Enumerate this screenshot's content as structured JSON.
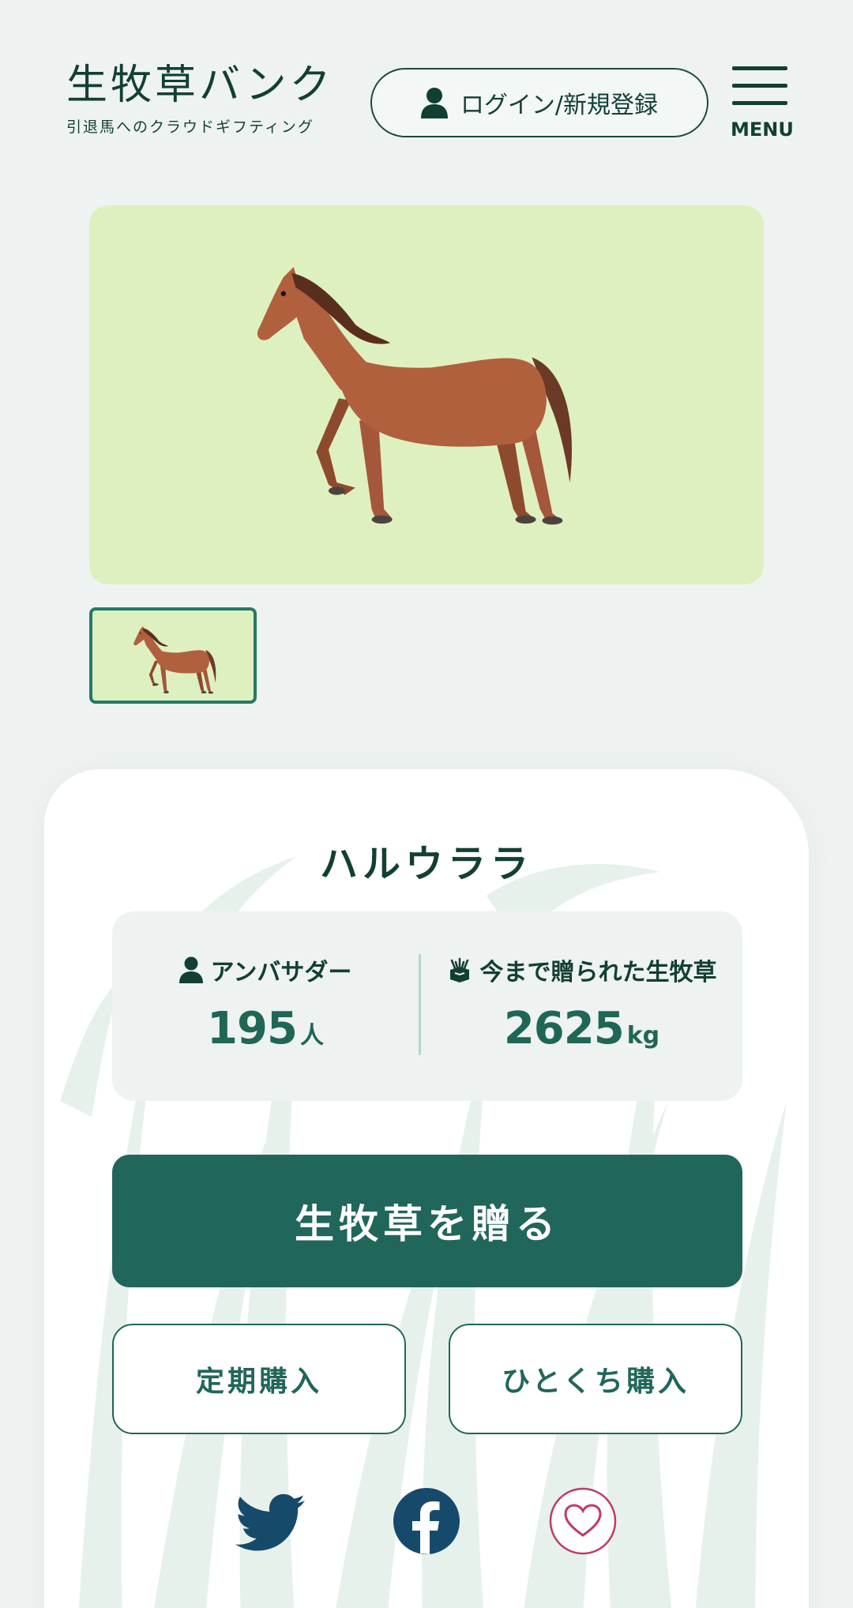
{
  "header": {
    "logo_title": "生牧草バンク",
    "logo_subtitle": "引退馬へのクラウドギフティング",
    "login_label": "ログイン/新規登録",
    "menu_label": "MENU"
  },
  "gallery": {
    "main_image": "horse-image",
    "thumbnails": [
      "horse-thumbnail"
    ]
  },
  "horse": {
    "name": "ハルウララ",
    "stats": {
      "ambassador_label": "アンバサダー",
      "ambassador_count": "195",
      "ambassador_unit": "人",
      "gifted_label": "今まで贈られた生牧草",
      "gifted_amount": "2625",
      "gifted_unit": "kg"
    }
  },
  "actions": {
    "gift_label": "生牧草を贈る",
    "subscription_label": "定期購入",
    "single_label": "ひとくち購入"
  },
  "social": {
    "icons": [
      "twitter-icon",
      "facebook-icon",
      "heart-icon"
    ]
  },
  "colors": {
    "primary": "#21665a",
    "text": "#123f34",
    "image_bg": "#dff0c0",
    "page_bg": "#eef3f2",
    "twitter": "#164a6b",
    "facebook": "#164a6b",
    "favorite": "#c0396b"
  }
}
